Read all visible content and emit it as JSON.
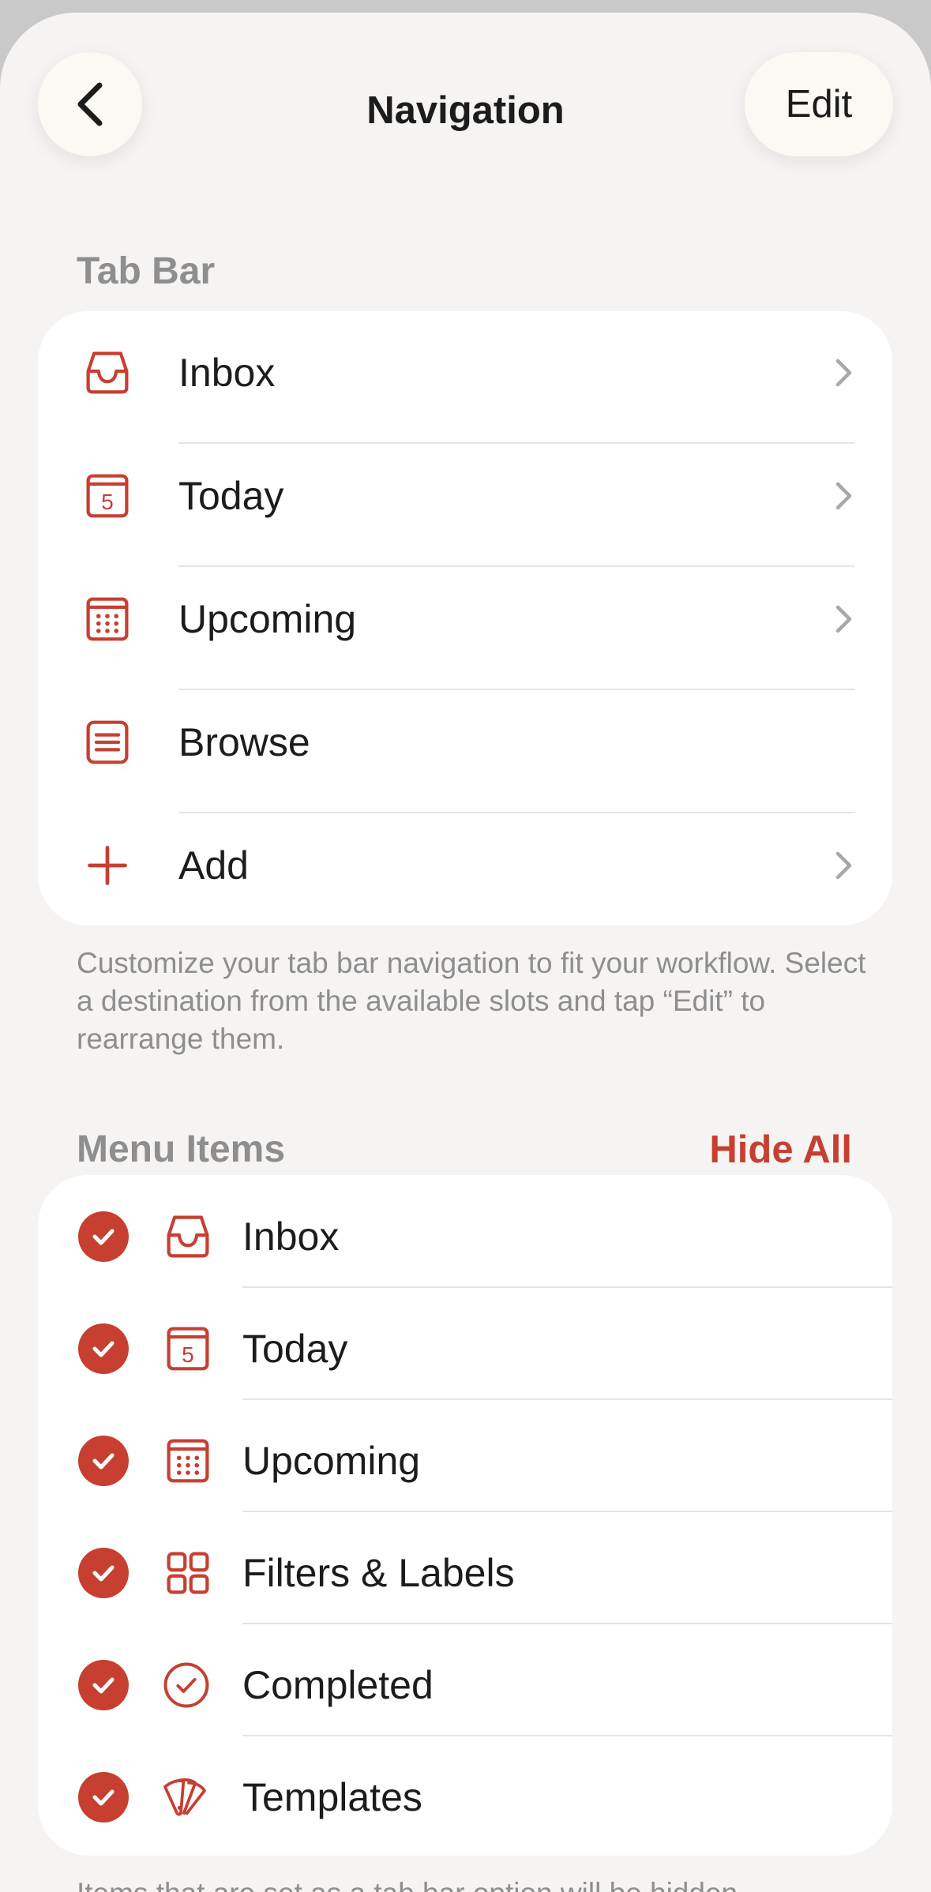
{
  "header": {
    "title": "Navigation",
    "edit_label": "Edit"
  },
  "tab_bar": {
    "section_title": "Tab Bar",
    "items": [
      {
        "label": "Inbox",
        "icon": "inbox-icon",
        "has_chevron": true
      },
      {
        "label": "Today",
        "icon": "calendar-today-icon",
        "has_chevron": true
      },
      {
        "label": "Upcoming",
        "icon": "calendar-grid-icon",
        "has_chevron": true
      },
      {
        "label": "Browse",
        "icon": "list-icon",
        "has_chevron": false
      },
      {
        "label": "Add",
        "icon": "plus-icon",
        "has_chevron": true
      }
    ],
    "footnote": "Customize your tab bar navigation to fit your workflow. Select a destination from the available slots and tap “Edit” to rearrange them."
  },
  "menu_items": {
    "section_title": "Menu Items",
    "hide_all_label": "Hide All",
    "items": [
      {
        "label": "Inbox",
        "icon": "inbox-icon",
        "checked": true
      },
      {
        "label": "Today",
        "icon": "calendar-today-icon",
        "checked": true
      },
      {
        "label": "Upcoming",
        "icon": "calendar-grid-icon",
        "checked": true
      },
      {
        "label": "Filters & Labels",
        "icon": "grid-four-icon",
        "checked": true
      },
      {
        "label": "Completed",
        "icon": "check-circle-icon",
        "checked": true
      },
      {
        "label": "Templates",
        "icon": "templates-icon",
        "checked": true
      }
    ],
    "footnote": "Items that are set as a tab bar option will be hidden"
  },
  "today_number": "5",
  "colors": {
    "accent": "#c63f31",
    "background": "#f5f4f2",
    "card": "#ffffff",
    "secondary_text": "#8e8e8e"
  }
}
